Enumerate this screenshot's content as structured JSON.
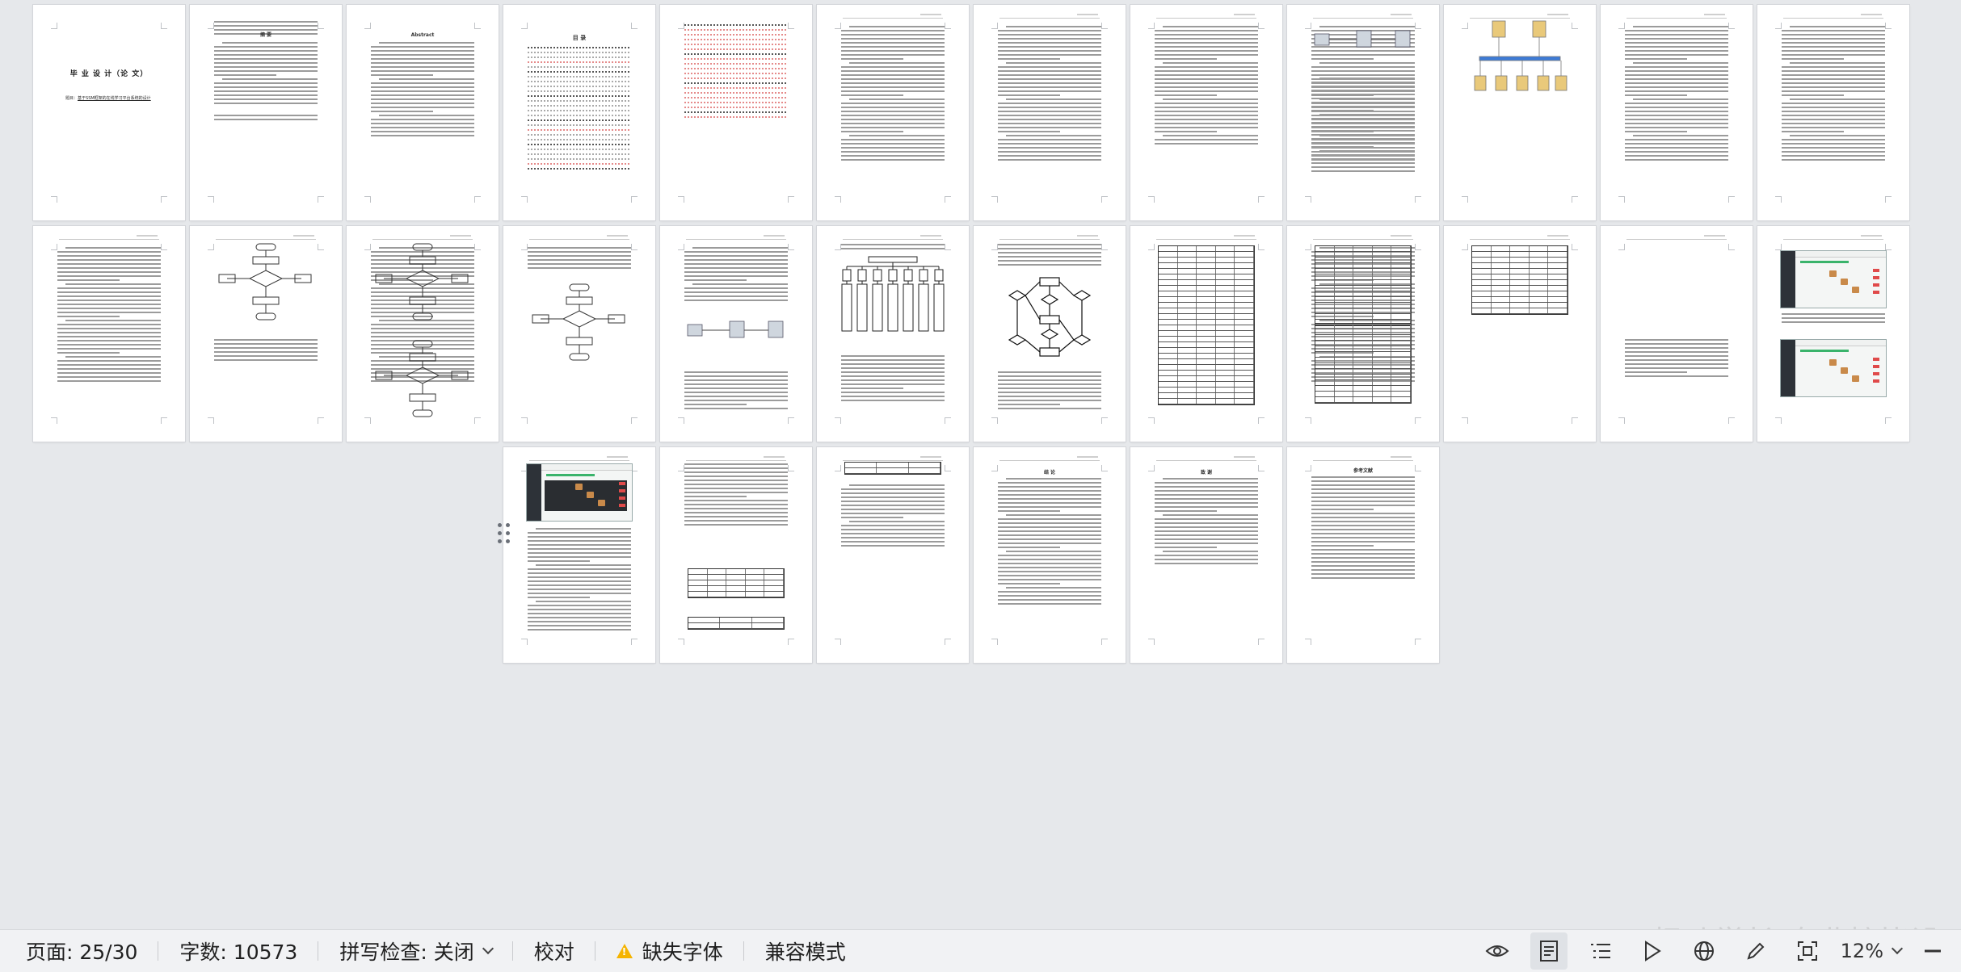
{
  "document": {
    "cover_title": "毕 业 设 计（论 文）",
    "cover_subtitle_label": "题目：",
    "cover_subtitle": "基于SSM框架的在线学习平台系统的设计",
    "abstract_cn_title": "摘 要",
    "abstract_en_title": "Abstract",
    "toc_title": "目 录",
    "ack_title": "致 谢",
    "summary_title": "结 论",
    "ref_title": "参考文献"
  },
  "statusbar": {
    "page_label": "页面: 25/30",
    "word_count": "字数: 10573",
    "spell_check": "拼写检查: 关闭",
    "proofread": "校对",
    "missing_font": "缺失字体",
    "compat_mode": "兼容模式",
    "zoom": "12%",
    "icons": [
      "eye-icon",
      "page-view-icon",
      "outline-view-icon",
      "play-icon",
      "web-view-icon",
      "pen-icon",
      "fit-page-icon",
      "zoom-out-icon"
    ]
  },
  "watermark": "CSDN @枫叶学长(专业接毕设)",
  "colors": {
    "background": "#e6e8eb",
    "statusbar": "#f1f2f4",
    "warning": "#f5b400",
    "green_accent": "#3ab36b"
  }
}
